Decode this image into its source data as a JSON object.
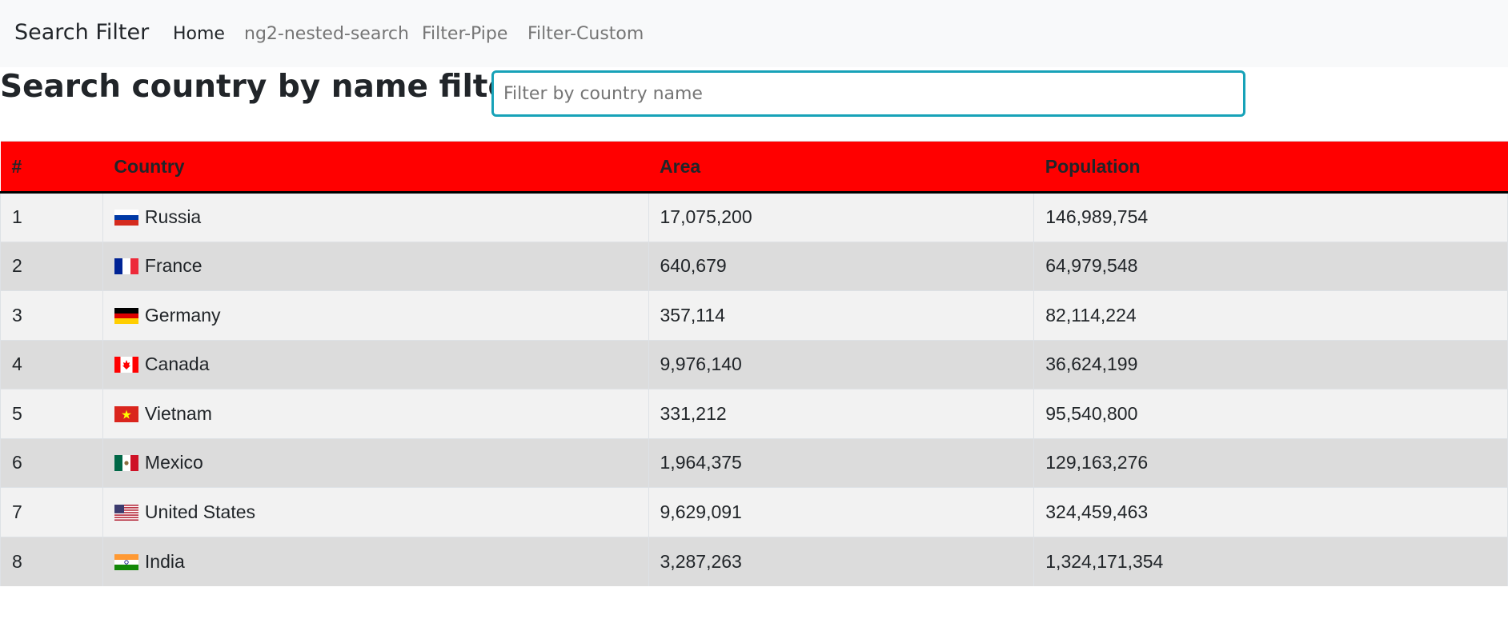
{
  "navbar": {
    "brand": "Search Filter",
    "links": [
      {
        "label": "Home",
        "active": true
      },
      {
        "label": "ng2-nested-search",
        "active": false
      },
      {
        "label": "Filter-Pipe",
        "active": false
      },
      {
        "label": "Filter-Custom",
        "active": false
      }
    ]
  },
  "search": {
    "title": "Search country by name filter :",
    "placeholder": "Filter by country name",
    "value": ""
  },
  "table": {
    "header_color": "#ff0000",
    "columns": [
      "#",
      "Country",
      "Area",
      "Population"
    ],
    "rows": [
      {
        "num": "1",
        "country": "Russia",
        "flag": "russia-flag-icon",
        "area": "17,075,200",
        "population": "146,989,754"
      },
      {
        "num": "2",
        "country": "France",
        "flag": "france-flag-icon",
        "area": "640,679",
        "population": "64,979,548"
      },
      {
        "num": "3",
        "country": "Germany",
        "flag": "germany-flag-icon",
        "area": "357,114",
        "population": "82,114,224"
      },
      {
        "num": "4",
        "country": "Canada",
        "flag": "canada-flag-icon",
        "area": "9,976,140",
        "population": "36,624,199"
      },
      {
        "num": "5",
        "country": "Vietnam",
        "flag": "vietnam-flag-icon",
        "area": "331,212",
        "population": "95,540,800"
      },
      {
        "num": "6",
        "country": "Mexico",
        "flag": "mexico-flag-icon",
        "area": "1,964,375",
        "population": "129,163,276"
      },
      {
        "num": "7",
        "country": "United States",
        "flag": "united-states-flag-icon",
        "area": "9,629,091",
        "population": "324,459,463"
      },
      {
        "num": "8",
        "country": "India",
        "flag": "india-flag-icon",
        "area": "3,287,263",
        "population": "1,324,171,354"
      }
    ]
  }
}
